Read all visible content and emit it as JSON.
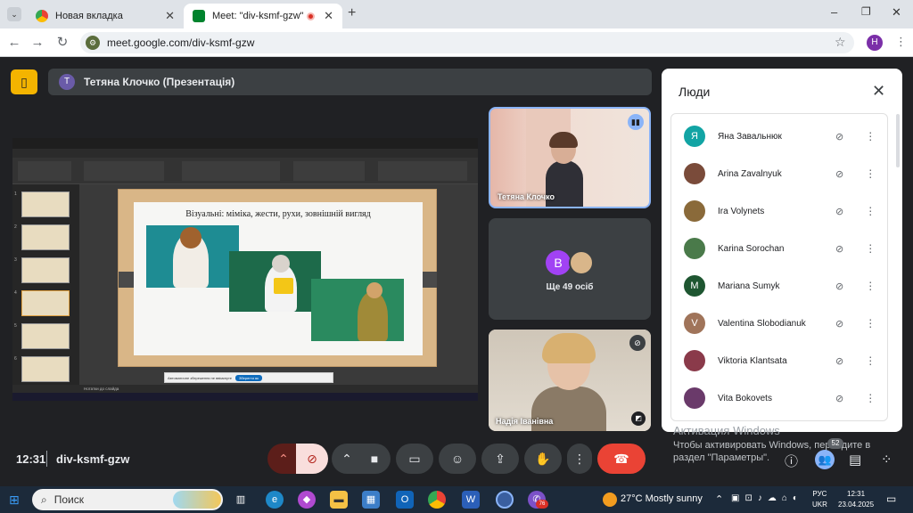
{
  "browser": {
    "tabs": [
      {
        "label": "Новая вкладка",
        "active": false
      },
      {
        "label": "Meet: \"div-ksmf-gzw\"",
        "active": true
      }
    ],
    "url": "meet.google.com/div-ksmf-gzw",
    "profile_initial": "H"
  },
  "meet": {
    "presenter_initial": "Т",
    "presenter_label": "Тетяна Клочко (Презентація)",
    "slide": {
      "title": "Візуальні: міміка, жести, рухи, зовнішній вигляд",
      "notes_placeholder": "Нотатки до слайда",
      "notification_text": "Автоматичне збереження не ввімкнуте",
      "notification_button": "Зберегти як"
    },
    "tiles": [
      {
        "name": "Тетяна Клочко"
      },
      {
        "initial": "B",
        "label": "Ще 49 осіб"
      },
      {
        "name": "Надія Іванівна"
      }
    ],
    "meeting_time": "12:31",
    "meeting_code": "div-ksmf-gzw",
    "participants_count": "52"
  },
  "people_panel": {
    "title": "Люди",
    "participants": [
      {
        "name": "Яна Завальнюк",
        "initial": "Я",
        "color": "#12a4a4"
      },
      {
        "name": "Arina Zavalnyuk",
        "initial": "",
        "color": "#7a4b3a"
      },
      {
        "name": "Ira Volynets",
        "initial": "",
        "color": "#8a6a3a"
      },
      {
        "name": "Karina Sorochan",
        "initial": "",
        "color": "#4a7a4a"
      },
      {
        "name": "Mariana Sumyk",
        "initial": "M",
        "color": "#1e5631"
      },
      {
        "name": "Valentina Slobodianuk",
        "initial": "V",
        "color": "#a0745a"
      },
      {
        "name": "Viktoria Klantsata",
        "initial": "",
        "color": "#8a3a4a"
      },
      {
        "name": "Vita Bokovets",
        "initial": "",
        "color": "#6a3a6a"
      }
    ]
  },
  "windows": {
    "activation_title": "Активация Windows",
    "activation_text": "Чтобы активировать Windows, перейдите в раздел \"Параметры\".",
    "search_placeholder": "Поиск",
    "weather": "27°C  Mostly sunny",
    "lang_top": "РУС",
    "lang_bottom": "UKR",
    "time": "12:31",
    "date": "23.04.2025",
    "notif_badge": "76"
  }
}
